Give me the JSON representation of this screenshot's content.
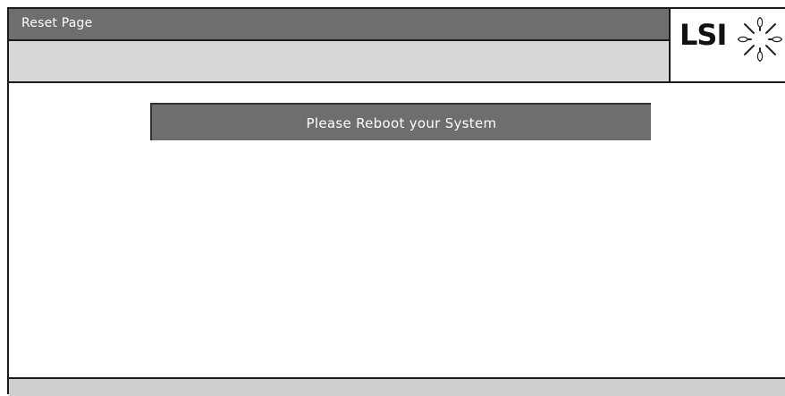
{
  "window": {
    "title": "Reset Page"
  },
  "logo": {
    "text": "LSI",
    "icon": "lsi-starburst-logo-icon"
  },
  "main": {
    "message": "Please Reboot your System"
  },
  "colors": {
    "title_bar": "#6e6e6e",
    "subheader": "#d8d8d8",
    "message_bar": "#6e6e6e",
    "footer": "#cfcfcf",
    "border": "#1a1a1a"
  }
}
